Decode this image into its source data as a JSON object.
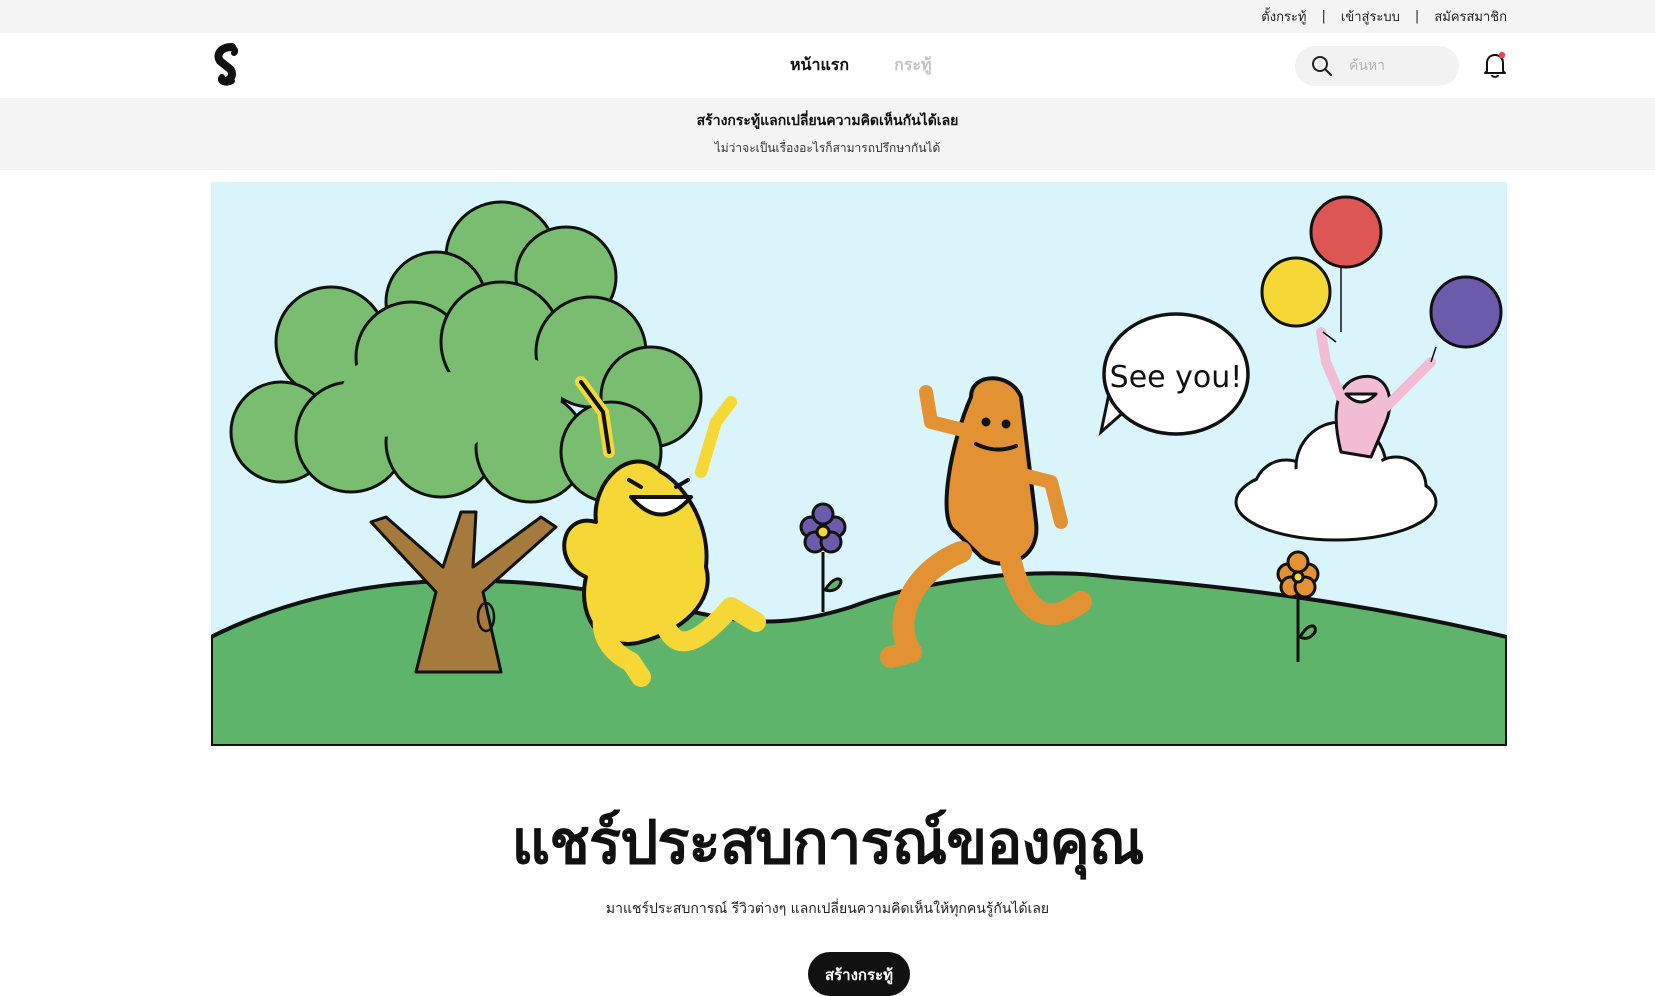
{
  "topbar": {
    "links": [
      "ตั้งกระทู้",
      "เข้าสู่ระบบ",
      "สมัครสมาชิก"
    ],
    "separator": "|"
  },
  "header": {
    "logo_icon": "s-logo-icon",
    "nav": [
      {
        "label": "หน้าแรก",
        "active": true
      },
      {
        "label": "กระทู้",
        "active": false
      }
    ],
    "search": {
      "placeholder": "ค้นหา",
      "value": "",
      "icon": "search-icon"
    },
    "notification_icon": "bell-icon",
    "notification_dot_color": "#e24a4a"
  },
  "banner": {
    "title": "สร้างกระทู้แลกเปลี่ยนความคิดเห็นกันได้เลย",
    "subtitle": "ไม่ว่าจะเป็นเรื่องอะไรก็สามารถปรึกษากันได้"
  },
  "hero": {
    "speech_bubble": "See you!",
    "sky_color": "#d9f5fb",
    "grass_color": "#5fb46b"
  },
  "main": {
    "headline": "แชร์ประสบการณ์ของคุณ",
    "subheadline": "มาแชร์ประสบการณ์ รีวิวต่างๆ แลกเปลี่ยนความคิดเห็นให้ทุกคนรู้กันได้เลย",
    "cta_label": "สร้างกระทู้"
  }
}
